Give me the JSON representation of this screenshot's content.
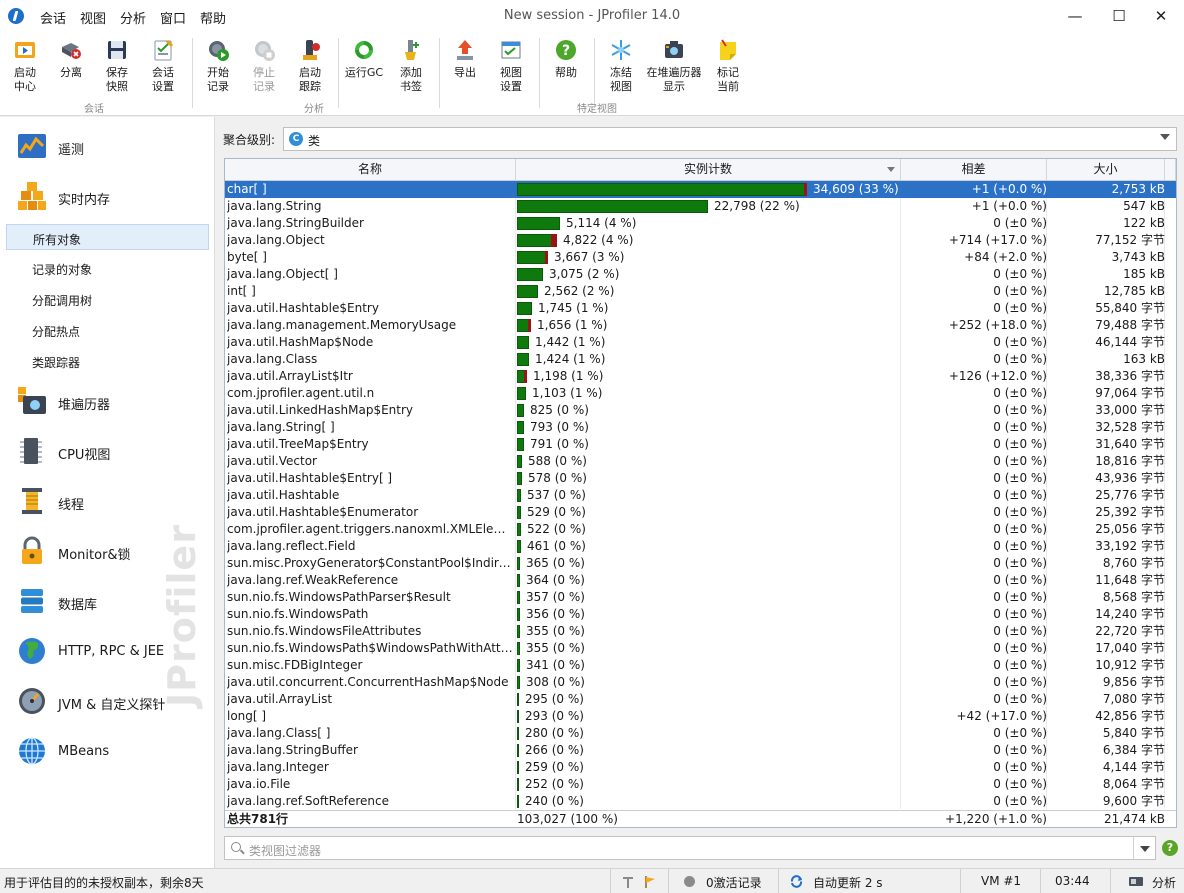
{
  "window": {
    "title": "New session - JProfiler 14.0"
  },
  "menu": [
    "会话",
    "视图",
    "分析",
    "窗口",
    "帮助"
  ],
  "window_controls": {
    "minimize": "—",
    "maximize": "☐",
    "close": "✕"
  },
  "toolbar": {
    "buttons": [
      {
        "label": "启动\n中心",
        "icon": "start-center-icon"
      },
      {
        "label": "分离",
        "icon": "detach-icon"
      },
      {
        "label": "保存\n快照",
        "icon": "save-snapshot-icon"
      },
      {
        "label": "会话\n设置",
        "icon": "session-settings-icon"
      },
      {
        "label": "开始\n记录",
        "icon": "start-recording-icon"
      },
      {
        "label": "停止\n记录",
        "icon": "stop-recording-icon"
      },
      {
        "label": "启动\n跟踪",
        "icon": "start-tracking-icon"
      },
      {
        "label": "运行GC",
        "icon": "run-gc-icon"
      },
      {
        "label": "添加\n书签",
        "icon": "add-bookmark-icon"
      },
      {
        "label": "导出",
        "icon": "export-icon"
      },
      {
        "label": "视图\n设置",
        "icon": "view-settings-icon"
      },
      {
        "label": "帮助",
        "icon": "help-icon"
      },
      {
        "label": "冻结\n视图",
        "icon": "freeze-view-icon"
      },
      {
        "label": "在堆遍历器\n显示",
        "icon": "show-in-heap-walker-icon"
      },
      {
        "label": "标记\n当前",
        "icon": "mark-current-icon"
      }
    ],
    "groups": [
      "会话",
      "分析",
      "特定视图"
    ]
  },
  "sidebar": {
    "main_items": [
      {
        "label": "遥测",
        "icon": "telemetry-icon"
      },
      {
        "label": "实时内存",
        "icon": "live-memory-icon"
      },
      {
        "label": "堆遍历器",
        "icon": "heap-walker-icon"
      },
      {
        "label": "CPU视图",
        "icon": "cpu-view-icon"
      },
      {
        "label": "线程",
        "icon": "threads-icon"
      },
      {
        "label": "Monitor&锁",
        "icon": "monitor-lock-icon"
      },
      {
        "label": "数据库",
        "icon": "database-icon"
      },
      {
        "label": "HTTP, RPC & JEE",
        "icon": "http-rpc-jee-icon"
      },
      {
        "label": "JVM & 自定义探针",
        "icon": "jvm-probes-icon"
      },
      {
        "label": "MBeans",
        "icon": "mbeans-icon"
      }
    ],
    "sub_items": [
      "所有对象",
      "记录的对象",
      "分配调用树",
      "分配热点",
      "类跟踪器"
    ],
    "watermark": "JProfiler"
  },
  "aggregation": {
    "label": "聚合级别:",
    "value": "类",
    "badge": "C"
  },
  "table": {
    "columns": [
      "名称",
      "实例计数",
      "相差",
      "大小"
    ],
    "rows": [
      {
        "name": "char[ ]",
        "count": 34609,
        "count_text": "34,609 (33 %)",
        "diff": "+1 (+0.0 %)",
        "size": "2,753 kB",
        "red": 0.002
      },
      {
        "name": "java.lang.String",
        "count": 22798,
        "count_text": "22,798 (22 %)",
        "diff": "+1 (+0.0 %)",
        "size": "547 kB",
        "red": 0
      },
      {
        "name": "java.lang.StringBuilder",
        "count": 5114,
        "count_text": "5,114 (4 %)",
        "diff": "0 (±0 %)",
        "size": "122 kB",
        "red": 0
      },
      {
        "name": "java.lang.Object",
        "count": 4822,
        "count_text": "4,822 (4 %)",
        "diff": "+714 (+17.0 %)",
        "size": "77,152 字节",
        "red": 0.15
      },
      {
        "name": "byte[ ]",
        "count": 3667,
        "count_text": "3,667 (3 %)",
        "diff": "+84 (+2.0 %)",
        "size": "3,743 kB",
        "red": 0.02
      },
      {
        "name": "java.lang.Object[ ]",
        "count": 3075,
        "count_text": "3,075 (2 %)",
        "diff": "0 (±0 %)",
        "size": "185 kB",
        "red": 0
      },
      {
        "name": "int[ ]",
        "count": 2562,
        "count_text": "2,562 (2 %)",
        "diff": "0 (±0 %)",
        "size": "12,785 kB",
        "red": 0
      },
      {
        "name": "java.util.Hashtable$Entry",
        "count": 1745,
        "count_text": "1,745 (1 %)",
        "diff": "0 (±0 %)",
        "size": "55,840 字节",
        "red": 0
      },
      {
        "name": "java.lang.management.MemoryUsage",
        "count": 1656,
        "count_text": "1,656 (1 %)",
        "diff": "+252 (+18.0 %)",
        "size": "79,488 字节",
        "red": 0.18
      },
      {
        "name": "java.util.HashMap$Node",
        "count": 1442,
        "count_text": "1,442 (1 %)",
        "diff": "0 (±0 %)",
        "size": "46,144 字节",
        "red": 0
      },
      {
        "name": "java.lang.Class",
        "count": 1424,
        "count_text": "1,424 (1 %)",
        "diff": "0 (±0 %)",
        "size": "163 kB",
        "red": 0
      },
      {
        "name": "java.util.ArrayList$Itr",
        "count": 1198,
        "count_text": "1,198 (1 %)",
        "diff": "+126 (+12.0 %)",
        "size": "38,336 字节",
        "red": 0.12
      },
      {
        "name": "com.jprofiler.agent.util.n",
        "count": 1103,
        "count_text": "1,103 (1 %)",
        "diff": "0 (±0 %)",
        "size": "97,064 字节",
        "red": 0
      },
      {
        "name": "java.util.LinkedHashMap$Entry",
        "count": 825,
        "count_text": "825 (0 %)",
        "diff": "0 (±0 %)",
        "size": "33,000 字节",
        "red": 0
      },
      {
        "name": "java.lang.String[ ]",
        "count": 793,
        "count_text": "793 (0 %)",
        "diff": "0 (±0 %)",
        "size": "32,528 字节",
        "red": 0
      },
      {
        "name": "java.util.TreeMap$Entry",
        "count": 791,
        "count_text": "791 (0 %)",
        "diff": "0 (±0 %)",
        "size": "31,640 字节",
        "red": 0
      },
      {
        "name": "java.util.Vector",
        "count": 588,
        "count_text": "588 (0 %)",
        "diff": "0 (±0 %)",
        "size": "18,816 字节",
        "red": 0
      },
      {
        "name": "java.util.Hashtable$Entry[ ]",
        "count": 578,
        "count_text": "578 (0 %)",
        "diff": "0 (±0 %)",
        "size": "43,936 字节",
        "red": 0
      },
      {
        "name": "java.util.Hashtable",
        "count": 537,
        "count_text": "537 (0 %)",
        "diff": "0 (±0 %)",
        "size": "25,776 字节",
        "red": 0
      },
      {
        "name": "java.util.Hashtable$Enumerator",
        "count": 529,
        "count_text": "529 (0 %)",
        "diff": "0 (±0 %)",
        "size": "25,392 字节",
        "red": 0
      },
      {
        "name": "com.jprofiler.agent.triggers.nanoxml.XMLElement",
        "count": 522,
        "count_text": "522 (0 %)",
        "diff": "0 (±0 %)",
        "size": "25,056 字节",
        "red": 0
      },
      {
        "name": "java.lang.reflect.Field",
        "count": 461,
        "count_text": "461 (0 %)",
        "diff": "0 (±0 %)",
        "size": "33,192 字节",
        "red": 0
      },
      {
        "name": "sun.misc.ProxyGenerator$ConstantPool$IndirectEntry",
        "count": 365,
        "count_text": "365 (0 %)",
        "diff": "0 (±0 %)",
        "size": "8,760 字节",
        "red": 0
      },
      {
        "name": "java.lang.ref.WeakReference",
        "count": 364,
        "count_text": "364 (0 %)",
        "diff": "0 (±0 %)",
        "size": "11,648 字节",
        "red": 0
      },
      {
        "name": "sun.nio.fs.WindowsPathParser$Result",
        "count": 357,
        "count_text": "357 (0 %)",
        "diff": "0 (±0 %)",
        "size": "8,568 字节",
        "red": 0
      },
      {
        "name": "sun.nio.fs.WindowsPath",
        "count": 356,
        "count_text": "356 (0 %)",
        "diff": "0 (±0 %)",
        "size": "14,240 字节",
        "red": 0
      },
      {
        "name": "sun.nio.fs.WindowsFileAttributes",
        "count": 355,
        "count_text": "355 (0 %)",
        "diff": "0 (±0 %)",
        "size": "22,720 字节",
        "red": 0
      },
      {
        "name": "sun.nio.fs.WindowsPath$WindowsPathWithAttributes",
        "count": 355,
        "count_text": "355 (0 %)",
        "diff": "0 (±0 %)",
        "size": "17,040 字节",
        "red": 0
      },
      {
        "name": "sun.misc.FDBigInteger",
        "count": 341,
        "count_text": "341 (0 %)",
        "diff": "0 (±0 %)",
        "size": "10,912 字节",
        "red": 0
      },
      {
        "name": "java.util.concurrent.ConcurrentHashMap$Node",
        "count": 308,
        "count_text": "308 (0 %)",
        "diff": "0 (±0 %)",
        "size": "9,856 字节",
        "red": 0
      },
      {
        "name": "java.util.ArrayList",
        "count": 295,
        "count_text": "295 (0 %)",
        "diff": "0 (±0 %)",
        "size": "7,080 字节",
        "red": 0
      },
      {
        "name": "long[ ]",
        "count": 293,
        "count_text": "293 (0 %)",
        "diff": "+42 (+17.0 %)",
        "size": "42,856 字节",
        "red": 0
      },
      {
        "name": "java.lang.Class[ ]",
        "count": 280,
        "count_text": "280 (0 %)",
        "diff": "0 (±0 %)",
        "size": "5,840 字节",
        "red": 0
      },
      {
        "name": "java.lang.StringBuffer",
        "count": 266,
        "count_text": "266 (0 %)",
        "diff": "0 (±0 %)",
        "size": "6,384 字节",
        "red": 0
      },
      {
        "name": "java.lang.Integer",
        "count": 259,
        "count_text": "259 (0 %)",
        "diff": "0 (±0 %)",
        "size": "4,144 字节",
        "red": 0
      },
      {
        "name": "java.io.File",
        "count": 252,
        "count_text": "252 (0 %)",
        "diff": "0 (±0 %)",
        "size": "8,064 字节",
        "red": 0
      },
      {
        "name": "java.lang.ref.SoftReference",
        "count": 240,
        "count_text": "240 (0 %)",
        "diff": "0 (±0 %)",
        "size": "9,600 字节",
        "red": 0
      }
    ],
    "total": {
      "label": "总共781行",
      "count": "103,027 (100 %)",
      "diff": "+1,220 (+1.0 %)",
      "size": "21,474 kB"
    }
  },
  "filter": {
    "placeholder": "类视图过滤器",
    "help": "?"
  },
  "statusbar": {
    "license": "用于评估目的的未授权副本，剩余8天",
    "recordings": "0激活记录",
    "auto_update": "自动更新 2 s",
    "vm": "VM #1",
    "time": "03:44",
    "mode": "分析"
  },
  "colors": {
    "bar": "#0e7a0e",
    "bar_increase": "#9b1414",
    "selection": "#2b72c6"
  }
}
